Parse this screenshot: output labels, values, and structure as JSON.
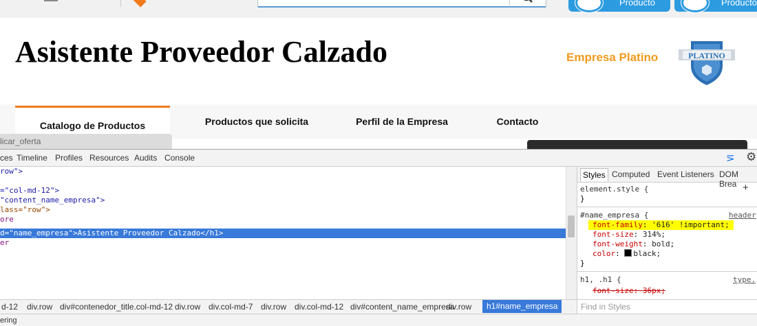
{
  "site": {
    "top_buttons": [
      "Producto",
      "Producto"
    ],
    "title": "Asistente Proveedor Calzado",
    "empresa_label": "Empresa Platino",
    "badge_text": "PLATINO",
    "nav": [
      "Catalogo de Productos",
      "Productos que solicita",
      "Perfil de la Empresa",
      "Contacto"
    ],
    "tooltip": "licar_oferta"
  },
  "devtools": {
    "tabs": [
      "ces",
      "Timeline",
      "Profiles",
      "Resources",
      "Audits",
      "Console"
    ],
    "code": [
      {
        "a": "row\">",
        "cls": "c-val"
      },
      {
        "a": ""
      },
      {
        "a": "=\"col-md-12\">"
      },
      {
        "a": "\"content_name_empresa\">"
      },
      {
        "a": "lass=\"row\">"
      },
      {
        "a": "ore"
      },
      {
        "a": "d=\"name_empresa\">Asistente Proveedor Calzado</h1>"
      },
      {
        "a": "er"
      }
    ],
    "styles_tabs": [
      "Styles",
      "Computed",
      "Event Listeners",
      "DOM Brea"
    ],
    "element_style": "element.style {",
    "close_brace": "}",
    "rule1_selector": "#name_empresa {",
    "rule1_source": "header",
    "rule1_props": [
      {
        "p": "font-family",
        "v": "'616' !important;"
      },
      {
        "p": "font-size",
        "v": "314%;"
      },
      {
        "p": "font-weight",
        "v": "bold;"
      },
      {
        "p": "color",
        "v": "black;"
      }
    ],
    "rule2_selector": "h1, .h1 {",
    "rule2_source": "type.",
    "rule2_prop": "font-size",
    "rule2_val": "36px;",
    "breadcrumbs": [
      "d-12",
      "div.row",
      "div#contenedor_title.col-md-12",
      "div.row",
      "div.col-md-7",
      "div.row",
      "div.col-md-12",
      "div#content_name_empresa",
      "div.row",
      "h1#name_empresa"
    ],
    "find_styles_placeholder": "Find in Styles",
    "status_text": "ering"
  }
}
